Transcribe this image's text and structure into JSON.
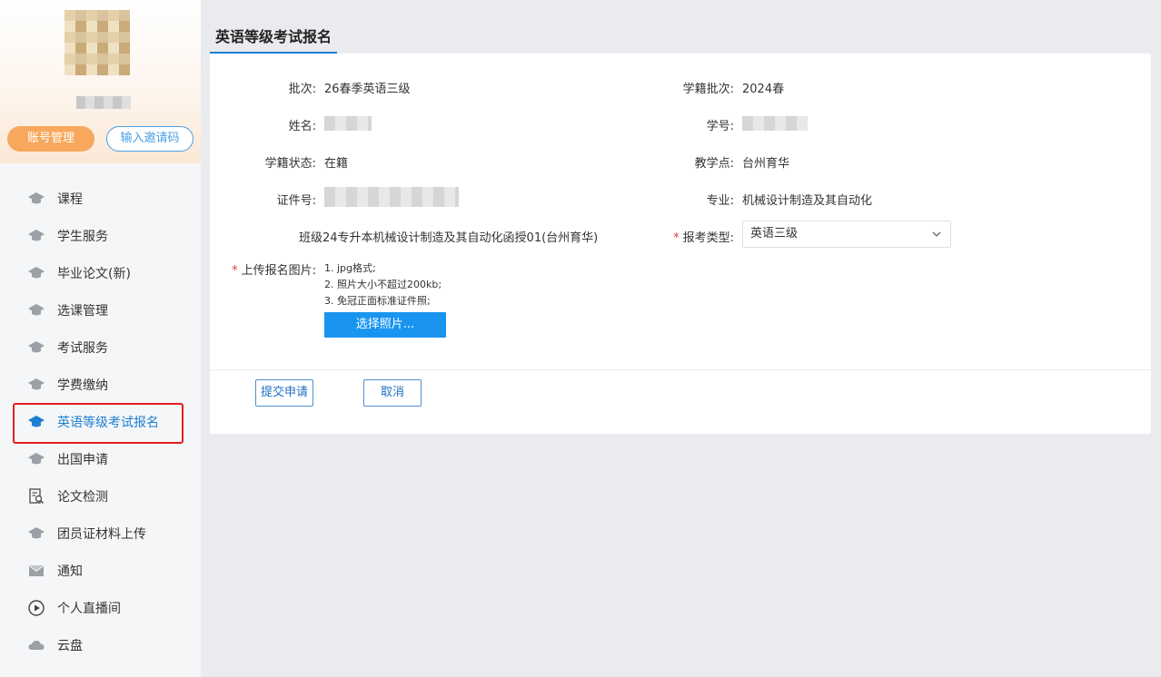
{
  "sidebar": {
    "account_button": "账号管理",
    "invite_button": "输入邀请码",
    "items": [
      {
        "label": "课程",
        "icon": "graduation-cap-icon"
      },
      {
        "label": "学生服务",
        "icon": "graduation-cap-icon"
      },
      {
        "label": "毕业论文(新)",
        "icon": "graduation-cap-icon"
      },
      {
        "label": "选课管理",
        "icon": "graduation-cap-icon"
      },
      {
        "label": "考试服务",
        "icon": "graduation-cap-icon"
      },
      {
        "label": "学费缴纳",
        "icon": "graduation-cap-icon"
      },
      {
        "label": "英语等级考试报名",
        "icon": "graduation-cap-icon"
      },
      {
        "label": "出国申请",
        "icon": "graduation-cap-icon"
      },
      {
        "label": "论文检测",
        "icon": "document-search-icon"
      },
      {
        "label": "团员证材料上传",
        "icon": "graduation-cap-icon"
      },
      {
        "label": "通知",
        "icon": "envelope-icon"
      },
      {
        "label": "个人直播间",
        "icon": "play-circle-icon"
      },
      {
        "label": "云盘",
        "icon": "cloud-icon"
      }
    ],
    "active_index": 6
  },
  "page": {
    "title": "英语等级考试报名"
  },
  "form": {
    "batch_label": "批次:",
    "batch_value": "26春季英语三级",
    "enroll_batch_label": "学籍批次:",
    "enroll_batch_value": "2024春",
    "name_label": "姓名:",
    "student_id_label": "学号:",
    "status_label": "学籍状态:",
    "status_value": "在籍",
    "center_label": "教学点:",
    "center_value": "台州育华",
    "id_number_label": "证件号:",
    "major_label": "专业:",
    "major_value": "机械设计制造及其自动化",
    "class_label": "班级",
    "class_value": "24专升本机械设计制造及其自动化函授01(台州育华)",
    "exam_type_label": "报考类型:",
    "exam_type_value": "英语三级",
    "upload_label": "上传报名图片:",
    "hints": [
      "1. jpg格式;",
      "2. 照片大小不超过200kb;",
      "3. 免冠正面标准证件照;"
    ],
    "choose_button": "选择照片...",
    "submit_button": "提交申请",
    "cancel_button": "取消"
  },
  "colors": {
    "accent": "#1d7fd1",
    "orange": "#f7a85c",
    "required": "#e53935",
    "highlight": "#e21e1e"
  }
}
